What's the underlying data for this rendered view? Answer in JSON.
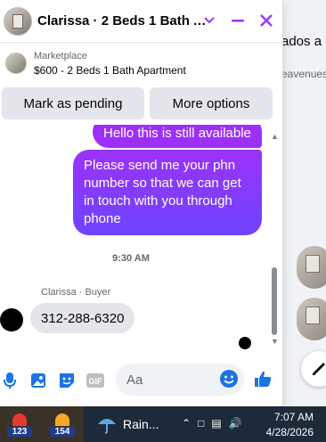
{
  "background": {
    "partial_text_1": "ados a l",
    "partial_text_2": "eavenues"
  },
  "chat": {
    "title": "Clarissa · 2 Beds 1 Bath Ap...",
    "listing_label": "Marketplace",
    "listing_value": "$600 - 2 Beds 1 Bath Apartment",
    "buttons": {
      "mark_pending": "Mark as pending",
      "more_options": "More options"
    },
    "messages": [
      {
        "from": "me",
        "text": "Hello this is still available"
      },
      {
        "from": "me",
        "text": "Please send me your phn number so that we can get in touch with you through phone"
      }
    ],
    "timestamp": "9:30 AM",
    "buyer_label": "Clarissa · Buyer",
    "buyer_message": "312-288-6320",
    "composer_placeholder": "Aa",
    "icons": [
      "chevron-down-icon",
      "minimize-icon",
      "close-icon",
      "microphone-icon",
      "image-icon",
      "sticker-icon",
      "gif-icon",
      "emoji-icon",
      "like-icon"
    ]
  },
  "taskbar": {
    "app1_badge": "123",
    "app2_badge": "154",
    "weather_text": "Rain...",
    "time": "7:07 AM",
    "date": "4/28/2026"
  },
  "colors": {
    "accent": "#a033ff",
    "brand_blue": "#1b74e4",
    "header_close": "#a033ff"
  }
}
